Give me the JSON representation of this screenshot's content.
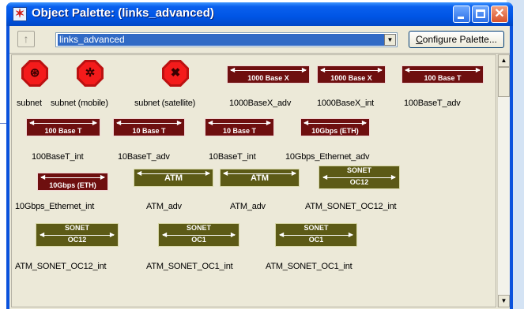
{
  "window": {
    "title": "Object Palette: (links_advanced)",
    "app_icon": "star-icon"
  },
  "toolbar": {
    "up_icon": "up-arrow-icon",
    "palette_value": "links_advanced",
    "configure_label_mnemonic": "C",
    "configure_label_rest": "onfigure Palette..."
  },
  "items": [
    {
      "label": "subnet",
      "icon": "subnet-icon"
    },
    {
      "label": "subnet (mobile)",
      "icon": "subnet-mobile-icon"
    },
    {
      "label": "subnet (satellite)",
      "icon": "subnet-satellite-icon"
    },
    {
      "label": "1000BaseX_adv",
      "icon_text": "1000 Base X"
    },
    {
      "label": "1000BaseX_int",
      "icon_text": "1000 Base X"
    },
    {
      "label": "100BaseT_adv",
      "icon_text": "100 Base T"
    },
    {
      "label": "100BaseT_int",
      "icon_text": "100 Base T"
    },
    {
      "label": "10BaseT_adv",
      "icon_text": "10 Base T"
    },
    {
      "label": "10BaseT_int",
      "icon_text": "10 Base T"
    },
    {
      "label": "10Gbps_Ethernet_adv",
      "icon_text": "10Gbps (ETH)"
    },
    {
      "label": "10Gbps_Ethernet_int",
      "icon_text": "10Gbps (ETH)"
    },
    {
      "label": "ATM_adv",
      "icon_text": "ATM"
    },
    {
      "label": "ATM_adv",
      "icon_text": "ATM"
    },
    {
      "label": "ATM_SONET_OC12_int",
      "icon_text_top": "SONET",
      "icon_text_bottom": "OC12"
    },
    {
      "label": "ATM_SONET_OC12_int",
      "icon_text_top": "SONET",
      "icon_text_bottom": "OC12"
    },
    {
      "label": "ATM_SONET_OC1_int",
      "icon_text_top": "SONET",
      "icon_text_bottom": "OC1"
    },
    {
      "label": "ATM_SONET_OC1_int",
      "icon_text_top": "SONET",
      "icon_text_bottom": "OC1"
    }
  ],
  "colors": {
    "link_eth": "#6e0f0f",
    "link_atm": "#5c5a16",
    "subnet": "#f41b1b",
    "selection": "#316ac5"
  }
}
